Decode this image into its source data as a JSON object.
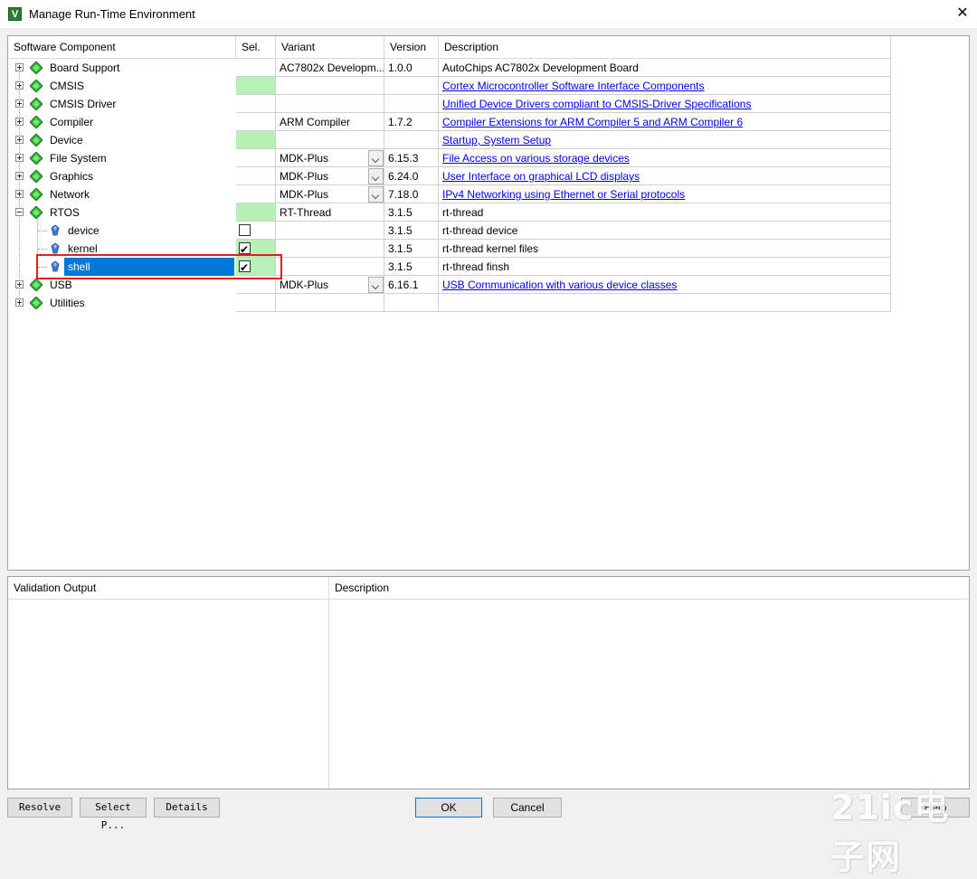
{
  "window": {
    "title": "Manage Run-Time Environment",
    "close_glyph": "✕"
  },
  "columns": {
    "component": "Software Component",
    "sel": "Sel.",
    "variant": "Variant",
    "version": "Version",
    "description": "Description"
  },
  "rows": [
    {
      "name": "Board Support",
      "kind": "group",
      "sel": "",
      "variant": "AC7802x Developm...",
      "version": "1.0.0",
      "desc": "AutoChips AC7802x Development Board",
      "link": false
    },
    {
      "name": "CMSIS",
      "kind": "group",
      "sel": "green",
      "variant": "",
      "version": "",
      "desc": "Cortex Microcontroller Software Interface Components",
      "link": true
    },
    {
      "name": "CMSIS Driver",
      "kind": "group",
      "sel": "",
      "variant": "",
      "version": "",
      "desc": "Unified Device Drivers compliant to CMSIS-Driver Specifications",
      "link": true
    },
    {
      "name": "Compiler",
      "kind": "group",
      "sel": "",
      "variant": "ARM Compiler",
      "version": "1.7.2",
      "desc": "Compiler Extensions for ARM Compiler 5 and ARM Compiler 6",
      "link": true
    },
    {
      "name": "Device",
      "kind": "group",
      "sel": "green",
      "variant": "",
      "version": "",
      "desc": "Startup, System Setup",
      "link": true
    },
    {
      "name": "File System",
      "kind": "group",
      "sel": "",
      "variant": "MDK-Plus",
      "dropdown": true,
      "version": "6.15.3",
      "desc": "File Access on various storage devices",
      "link": true
    },
    {
      "name": "Graphics",
      "kind": "group",
      "sel": "",
      "variant": "MDK-Plus",
      "dropdown": true,
      "version": "6.24.0",
      "desc": "User Interface on graphical LCD displays",
      "link": true
    },
    {
      "name": "Network",
      "kind": "group",
      "sel": "",
      "variant": "MDK-Plus",
      "dropdown": true,
      "version": "7.18.0",
      "desc": "IPv4 Networking using Ethernet or Serial protocols",
      "link": true
    },
    {
      "name": "RTOS",
      "kind": "group-open",
      "sel": "green",
      "variant": "RT-Thread",
      "version": "3.1.5",
      "desc": "rt-thread",
      "link": false
    },
    {
      "name": "device",
      "kind": "leaf",
      "sel": "unchecked",
      "variant": "",
      "version": "3.1.5",
      "desc": "rt-thread device",
      "link": false
    },
    {
      "name": "kernel",
      "kind": "leaf",
      "sel": "checked",
      "variant": "",
      "version": "3.1.5",
      "desc": "rt-thread kernel files",
      "link": false
    },
    {
      "name": "shell",
      "kind": "leaf-selected",
      "sel": "checked",
      "variant": "",
      "version": "3.1.5",
      "desc": "rt-thread finsh",
      "link": false
    },
    {
      "name": "USB",
      "kind": "group",
      "sel": "",
      "variant": "MDK-Plus",
      "dropdown": true,
      "version": "6.16.1",
      "desc": "USB Communication with various device classes",
      "link": true
    },
    {
      "name": "Utilities",
      "kind": "group",
      "sel": "",
      "variant": "",
      "version": "",
      "desc": "",
      "link": false
    }
  ],
  "validation": {
    "output_header": "Validation Output",
    "description_header": "Description"
  },
  "buttons": {
    "resolve": "Resolve",
    "select_packs": "Select P...",
    "details": "Details",
    "ok": "OK",
    "cancel": "Cancel",
    "help": "Help"
  },
  "watermark": "21ic电子网",
  "colors": {
    "selection": "#0078d7",
    "green": "#b7f0b7",
    "link": "#0000ee",
    "highlight": "#e02020"
  }
}
